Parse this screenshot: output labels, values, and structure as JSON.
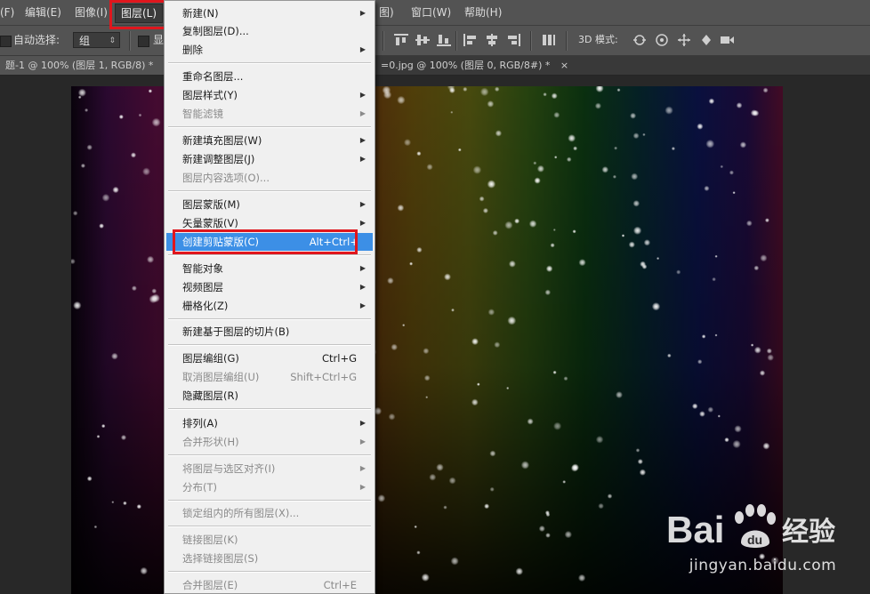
{
  "menubar": {
    "items": [
      {
        "label": "(F)"
      },
      {
        "label": "编辑(E)"
      },
      {
        "label": "图像(I)"
      },
      {
        "label": "图层(L)"
      },
      {
        "label": "图)"
      },
      {
        "label": "窗口(W)"
      },
      {
        "label": "帮助(H)"
      }
    ]
  },
  "options": {
    "auto_select_label": "自动选择:",
    "group_select_value": "组",
    "show_transform_label": "显",
    "mode_3d_label": "3D 模式:"
  },
  "tabs": {
    "doc1": "题-1 @ 100% (图层 1, RGB/8) *",
    "doc1_close": "×",
    "doc2": "=0.jpg @ 100% (图层 0, RGB/8#) *",
    "doc2_close": "×"
  },
  "layer_menu": {
    "items": [
      {
        "label": "新建(N)",
        "arrow": "▶"
      },
      {
        "label": "复制图层(D)..."
      },
      {
        "label": "删除",
        "arrow": "▶"
      },
      {
        "label": "重命名图层..."
      },
      {
        "label": "图层样式(Y)",
        "arrow": "▶"
      },
      {
        "label": "智能滤镜",
        "arrow": "▶"
      },
      {
        "label": "新建填充图层(W)",
        "arrow": "▶"
      },
      {
        "label": "新建调整图层(J)",
        "arrow": "▶"
      },
      {
        "label": "图层内容选项(O)..."
      },
      {
        "label": "图层蒙版(M)",
        "arrow": "▶"
      },
      {
        "label": "矢量蒙版(V)",
        "arrow": "▶"
      },
      {
        "label": "创建剪贴蒙版(C)",
        "shortcut": "Alt+Ctrl+"
      },
      {
        "label": "智能对象",
        "arrow": "▶"
      },
      {
        "label": "视频图层",
        "arrow": "▶"
      },
      {
        "label": "栅格化(Z)",
        "arrow": "▶"
      },
      {
        "label": "新建基于图层的切片(B)"
      },
      {
        "label": "图层编组(G)",
        "shortcut": "Ctrl+G"
      },
      {
        "label": "取消图层编组(U)",
        "shortcut": "Shift+Ctrl+G"
      },
      {
        "label": "隐藏图层(R)"
      },
      {
        "label": "排列(A)",
        "arrow": "▶"
      },
      {
        "label": "合并形状(H)",
        "arrow": "▶"
      },
      {
        "label": "将图层与选区对齐(I)",
        "arrow": "▶"
      },
      {
        "label": "分布(T)",
        "arrow": "▶"
      },
      {
        "label": "锁定组内的所有图层(X)..."
      },
      {
        "label": "链接图层(K)"
      },
      {
        "label": "选择链接图层(S)"
      },
      {
        "label": "合并图层(E)",
        "shortcut": "Ctrl+E"
      }
    ]
  },
  "watermark": {
    "brand_left": "Bai",
    "brand_right": "经验",
    "url": "jingyan.baidu.com"
  },
  "colors": {
    "highlight": "#3c8fe6",
    "annotation_red": "#e0161d",
    "menubar_bg": "#535353"
  }
}
